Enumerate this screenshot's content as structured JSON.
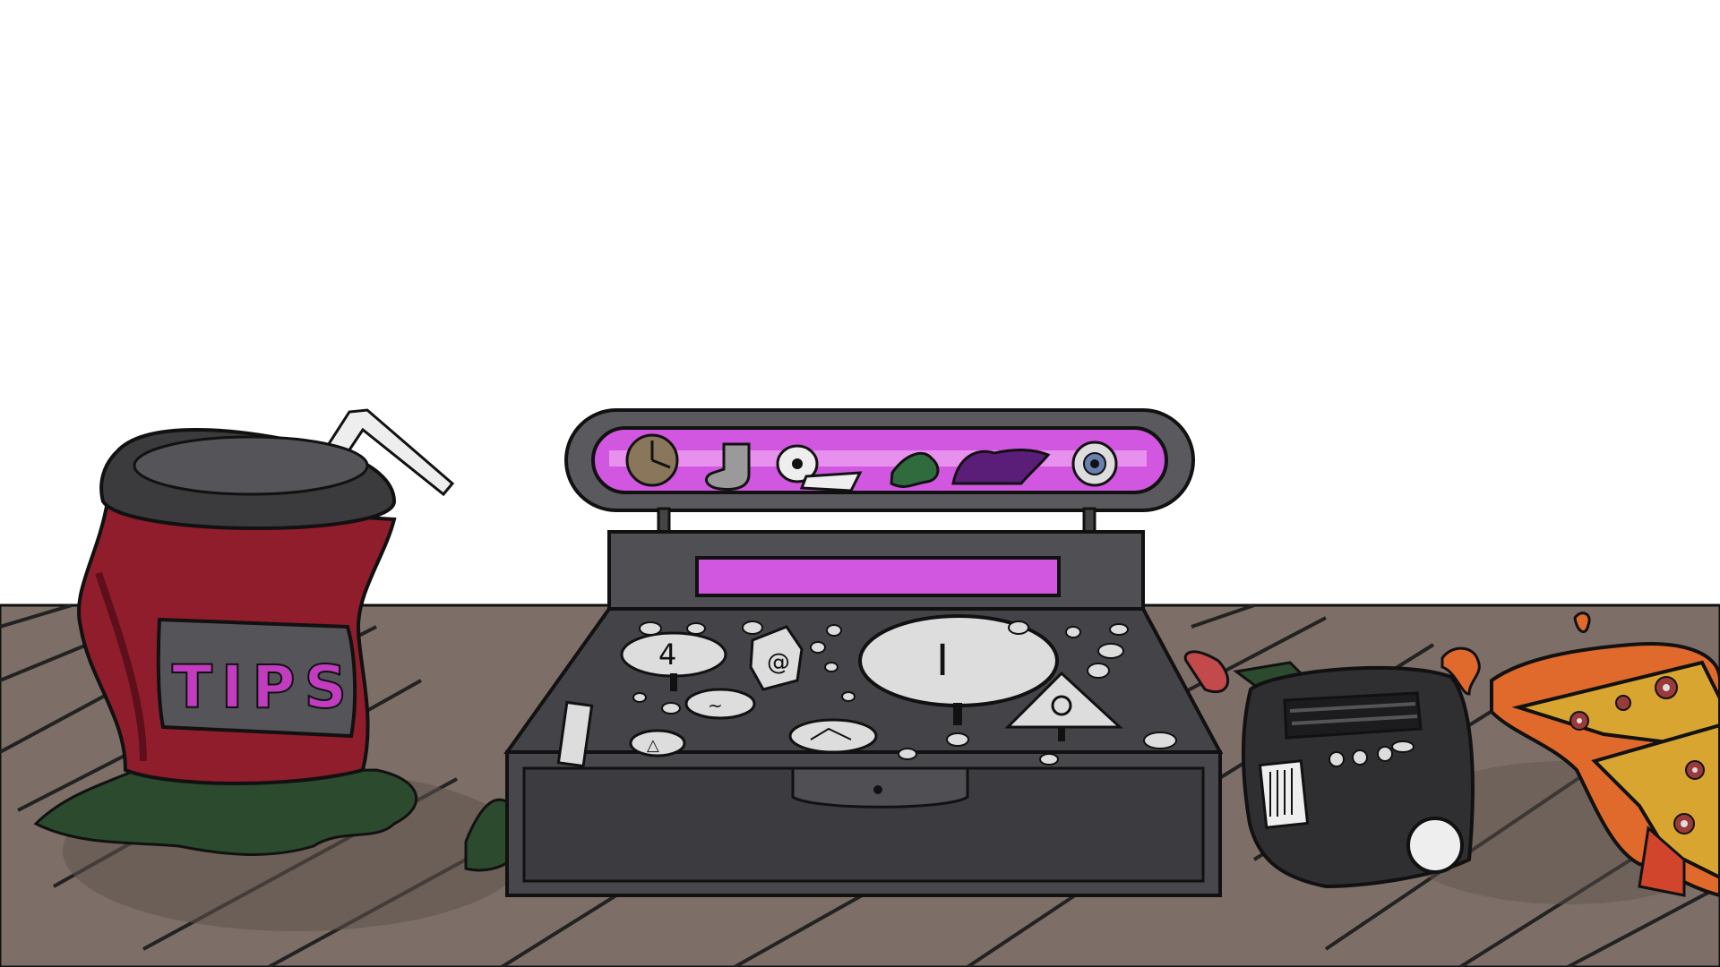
{
  "scene": {
    "name": "shop-counter-scene",
    "colors": {
      "wall": "#ffffff",
      "floor": "#7d6f67",
      "floor_shadow": "#5e524b",
      "outline": "#111111",
      "register_body": "#4f4f52",
      "register_face": "#3f3f42",
      "display_glow": "#d257e0",
      "cup_red": "#8f1d2c",
      "cup_lid": "#3b3b3e",
      "tips_letters": "#c23cc0",
      "slime": "#2b4a2e",
      "toaster": "#2f2f31",
      "sauce": "#e06a2c"
    }
  },
  "tip_cup": {
    "label": "TIPS"
  },
  "register": {
    "display_items": [
      {
        "icon": "clock-icon"
      },
      {
        "icon": "sock-icon"
      },
      {
        "icon": "toilet-paper-icon"
      },
      {
        "icon": "green-creature-icon"
      },
      {
        "icon": "purple-cloth-icon"
      },
      {
        "icon": "eyeball-icon"
      }
    ],
    "dials": [
      {
        "icon": "glyph-4-dial"
      },
      {
        "icon": "glyph-spiral-dial"
      },
      {
        "icon": "glyph-h-big-dial"
      },
      {
        "icon": "glyph-wave-dial"
      },
      {
        "icon": "glyph-triangle-dial"
      },
      {
        "icon": "glyph-nodes-dial"
      },
      {
        "icon": "glyph-eye-triangle-dial"
      }
    ]
  },
  "toaster": {
    "buttons": 4
  }
}
